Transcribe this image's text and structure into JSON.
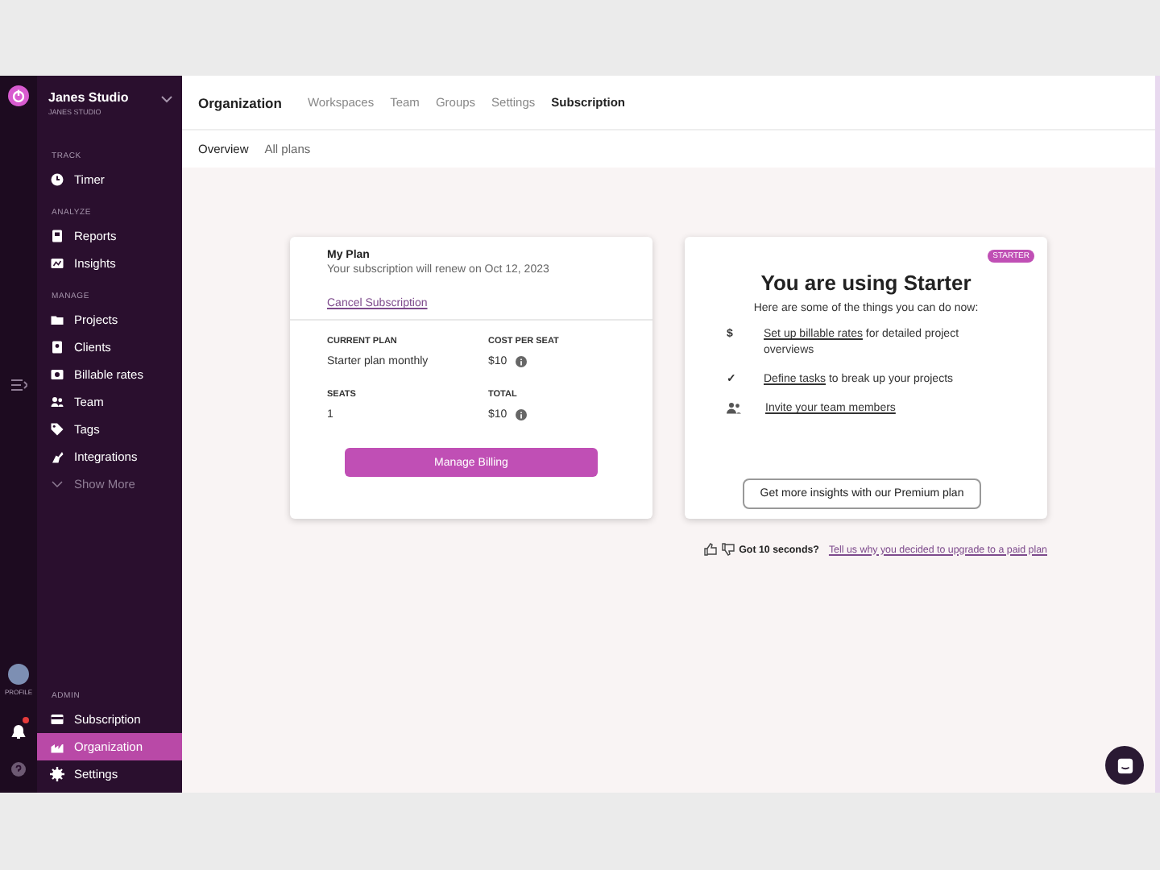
{
  "rail": {
    "profile_label": "PROFILE",
    "notifications": true
  },
  "workspace": {
    "name": "Janes Studio",
    "subtitle": "JANES STUDIO"
  },
  "sidebar": {
    "sections": [
      {
        "title": "TRACK",
        "items": [
          {
            "label": "Timer",
            "selected": false
          }
        ]
      },
      {
        "title": "ANALYZE",
        "items": [
          {
            "label": "Reports",
            "selected": false
          },
          {
            "label": "Insights",
            "selected": false
          }
        ]
      },
      {
        "title": "MANAGE",
        "items": [
          {
            "label": "Projects",
            "selected": false
          },
          {
            "label": "Clients",
            "selected": false
          },
          {
            "label": "Billable rates",
            "selected": false
          },
          {
            "label": "Team",
            "selected": false
          },
          {
            "label": "Tags",
            "selected": false
          },
          {
            "label": "Integrations",
            "selected": false
          }
        ]
      }
    ],
    "show_more": "Show More",
    "admin": {
      "title": "ADMIN",
      "items": [
        {
          "label": "Subscription",
          "selected": false
        },
        {
          "label": "Organization",
          "selected": true
        },
        {
          "label": "Settings",
          "selected": false
        }
      ]
    }
  },
  "page_title": "Organization",
  "tabs": [
    {
      "label": "Workspaces",
      "selected": false
    },
    {
      "label": "Team",
      "selected": false
    },
    {
      "label": "Groups",
      "selected": false
    },
    {
      "label": "Settings",
      "selected": false
    },
    {
      "label": "Subscription",
      "selected": true
    }
  ],
  "subtabs": [
    {
      "label": "Overview",
      "selected": true
    },
    {
      "label": "All plans",
      "selected": false
    }
  ],
  "plan_card": {
    "title": "My Plan",
    "renewal": "Your subscription will renew on Oct 12, 2023",
    "cancel_link": "Cancel Subscription",
    "fields": [
      {
        "label": "CURRENT PLAN",
        "value": "Starter plan monthly",
        "info": false
      },
      {
        "label": "COST PER SEAT",
        "value": "$10",
        "info": true
      },
      {
        "label": "SEATS",
        "value": "1",
        "info": false
      },
      {
        "label": "TOTAL",
        "value": "$10",
        "info": true
      }
    ],
    "button": "Manage Billing"
  },
  "starter_card": {
    "badge": "STARTER",
    "title": "You are using Starter",
    "subtitle": "Here are some of the things you can do now:",
    "items": [
      {
        "icon": "$",
        "link": "Set up billable rates",
        "rest": " for detailed project overviews"
      },
      {
        "icon": "✓",
        "link": "Define tasks",
        "rest": " to break up your projects"
      },
      {
        "link": "Invite your team members"
      }
    ],
    "button": "Get more insights with our Premium plan"
  },
  "feedback": {
    "question": "Got 10 seconds?",
    "link": "Tell us why you decided to upgrade to a paid plan"
  }
}
